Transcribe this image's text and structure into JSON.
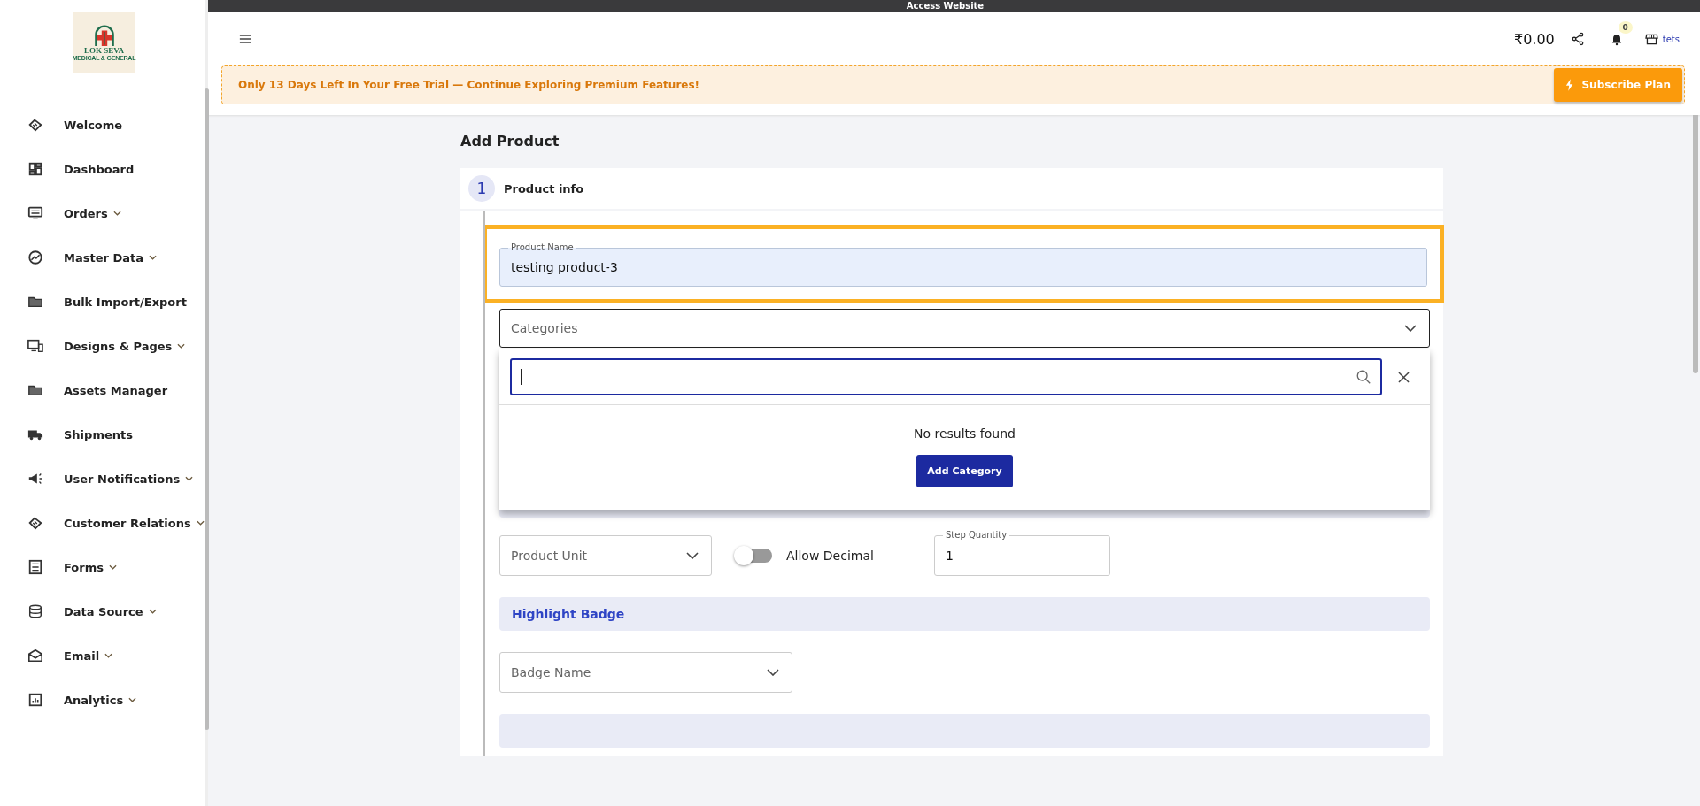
{
  "top_bar": {
    "link": "Access Website"
  },
  "sidebar": {
    "logo": {
      "title": "LOK SEVA",
      "subtitle": "MEDICAL & GENERAL"
    },
    "items": [
      {
        "label": "Welcome",
        "expandable": false
      },
      {
        "label": "Dashboard",
        "expandable": false
      },
      {
        "label": "Orders",
        "expandable": true
      },
      {
        "label": "Master Data",
        "expandable": true
      },
      {
        "label": "Bulk Import/Export",
        "expandable": false
      },
      {
        "label": "Designs & Pages",
        "expandable": true
      },
      {
        "label": "Assets Manager",
        "expandable": false
      },
      {
        "label": "Shipments",
        "expandable": false
      },
      {
        "label": "User Notifications",
        "expandable": true
      },
      {
        "label": "Customer Relations",
        "expandable": true
      },
      {
        "label": "Forms",
        "expandable": true
      },
      {
        "label": "Data Source",
        "expandable": true
      },
      {
        "label": "Email",
        "expandable": true
      },
      {
        "label": "Analytics",
        "expandable": true
      }
    ]
  },
  "header": {
    "balance": "₹0.00",
    "notifications": "0",
    "store": "tets"
  },
  "trial_banner": {
    "message": "Only 13 Days Left In Your Free Trial — Continue Exploring Premium Features!",
    "button": "Subscribe Plan"
  },
  "page_title": "Add Product",
  "step": {
    "number": "1",
    "title": "Product info"
  },
  "form": {
    "product_name": {
      "label": "Product Name",
      "value": "testing product-3",
      "highlighted": true
    },
    "categories": {
      "placeholder": "Categories",
      "open": true
    },
    "category_popup": {
      "empty_text": "No results found",
      "button": "Add Category"
    },
    "product_unit": {
      "placeholder": "Product Unit"
    },
    "allow_decimal": {
      "label": "Allow Decimal",
      "on": false
    },
    "step_quantity": {
      "label": "Step Quantity",
      "value": "1"
    },
    "highlight_badge": {
      "title": "Highlight Badge"
    },
    "badge_name": {
      "placeholder": "Badge Name"
    }
  }
}
